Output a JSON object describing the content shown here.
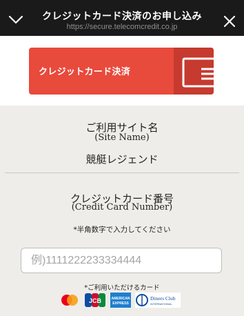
{
  "header": {
    "title": "クレジットカード決済のお申し込み",
    "url": "https://secure.telecomcredit.co.jp"
  },
  "banner": {
    "label": "クレジットカード決済"
  },
  "site": {
    "label": "ご利用サイト名",
    "label_en": "(Site Name)",
    "value": "競艇レジェンド"
  },
  "card_number": {
    "label": "クレジットカード番号",
    "label_en": "(Credit Card Number)",
    "note": "*半角数字で入力してください",
    "placeholder": "例)1111222233334444",
    "value": ""
  },
  "accepted_cards": {
    "label": "*ご利用いただけるカード",
    "brands": [
      "mastercard",
      "jcb",
      "american-express",
      "diners-club"
    ],
    "amex_text": "AMERICAN EXPRESS",
    "diners_text": "Diners Club",
    "diners_sub": "INTERNATIONAL",
    "jcb_text": "JCB"
  }
}
